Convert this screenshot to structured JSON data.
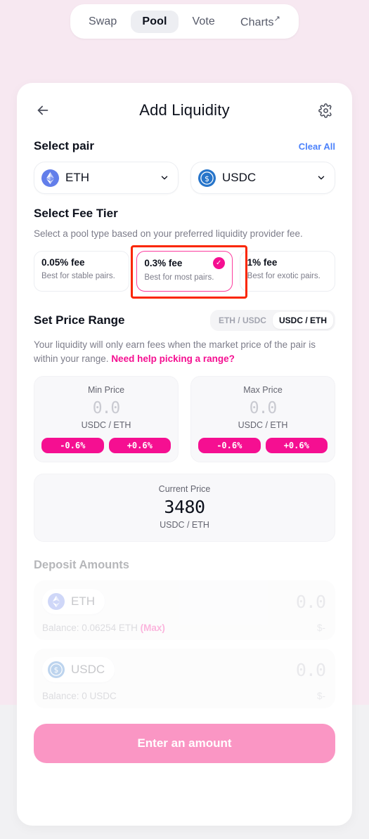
{
  "topnav": {
    "items": [
      {
        "label": "Swap",
        "active": false,
        "external": false
      },
      {
        "label": "Pool",
        "active": true,
        "external": false
      },
      {
        "label": "Vote",
        "active": false,
        "external": false
      },
      {
        "label": "Charts",
        "active": false,
        "external": true
      }
    ],
    "external_arrow": "↗"
  },
  "header": {
    "back_icon": "arrow-left-icon",
    "title": "Add Liquidity",
    "settings_icon": "gear-icon"
  },
  "select_pair": {
    "title": "Select pair",
    "clear_all": "Clear All",
    "tokens": [
      {
        "symbol": "ETH",
        "icon": "ethereum-icon",
        "chevron": "⌄"
      },
      {
        "symbol": "USDC",
        "icon": "usdc-icon",
        "chevron": "⌄"
      }
    ]
  },
  "fee_tier": {
    "title": "Select Fee Tier",
    "subtitle": "Select a pool type based on your preferred liquidity provider fee.",
    "selected_index": 1,
    "check_glyph": "✓",
    "options": [
      {
        "name": "0.05% fee",
        "desc": "Best for stable pairs."
      },
      {
        "name": "0.3% fee",
        "desc": "Best for most pairs."
      },
      {
        "name": "1% fee",
        "desc": "Best for exotic pairs."
      }
    ],
    "highlight_color": "#fa2600",
    "selected_color": "#f50f91"
  },
  "price_range": {
    "title": "Set Price Range",
    "toggle": [
      {
        "label": "ETH / USDC",
        "active": false
      },
      {
        "label": "USDC / ETH",
        "active": true
      }
    ],
    "note_text": "Your liquidity will only earn fees when the market price of the pair is within your range. ",
    "note_link": "Need help picking a range?",
    "min": {
      "label": "Min Price",
      "value": "0.0",
      "pair": "USDC / ETH",
      "dec_label": "-0.6%",
      "inc_label": "+0.6%"
    },
    "max": {
      "label": "Max Price",
      "value": "0.0",
      "pair": "USDC / ETH",
      "dec_label": "-0.6%",
      "inc_label": "+0.6%"
    },
    "current": {
      "label": "Current Price",
      "value": "3480",
      "pair": "USDC / ETH"
    }
  },
  "deposit": {
    "title": "Deposit Amounts",
    "rows": [
      {
        "symbol": "ETH",
        "icon": "ethereum-icon",
        "amount": "0.0",
        "balance": "Balance: 0.06254 ETH ",
        "max_label": "(Max)",
        "usd": "$-"
      },
      {
        "symbol": "USDC",
        "icon": "usdc-icon",
        "amount": "0.0",
        "balance": "Balance: 0 USDC",
        "max_label": "",
        "usd": "$-"
      }
    ]
  },
  "cta": {
    "label": "Enter an amount"
  }
}
